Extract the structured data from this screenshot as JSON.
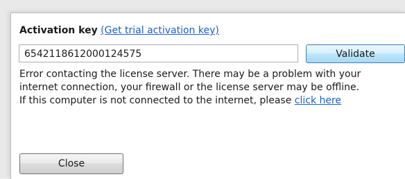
{
  "activation": {
    "label": "Activation key",
    "trial_link": "(Get trial activation key)",
    "key_value": "6542118612000124575",
    "validate_label": "Validate"
  },
  "error": {
    "line1": "Error contacting the license server. There may be a problem with your",
    "line2": "internet connection, your firewall or the license server may be offline.",
    "line3_prefix": "If this computer is not connected to the internet, please ",
    "click_here": "click here"
  },
  "footer": {
    "close_label": "Close"
  },
  "colors": {
    "link": "#1a5fd0",
    "text": "#1a1a1a",
    "background": "#ffffff"
  }
}
